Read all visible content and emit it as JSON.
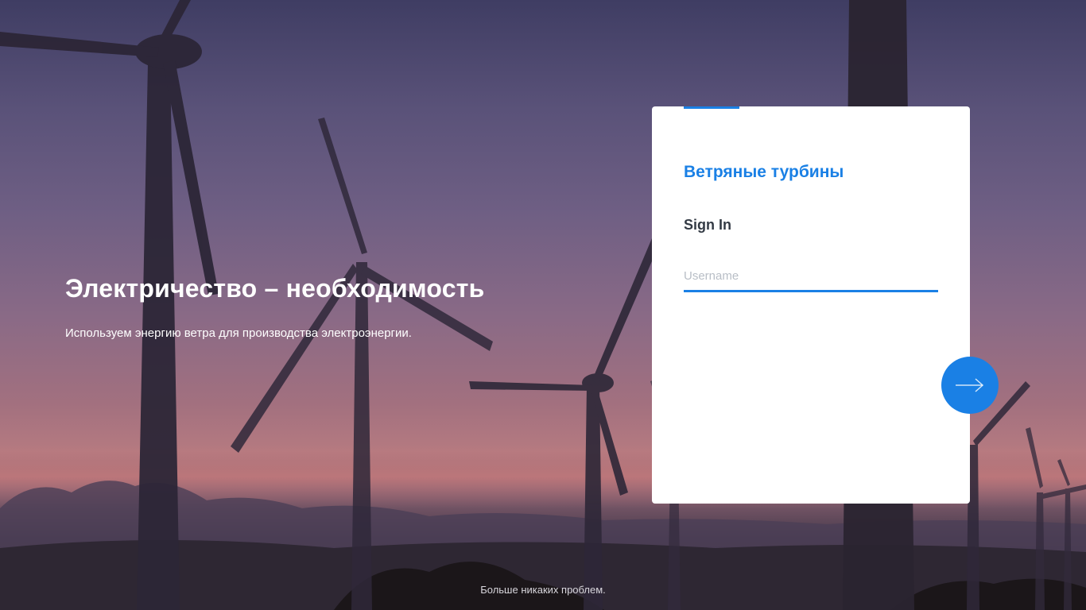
{
  "hero": {
    "title": "Электричество – необходимость",
    "subtitle": "Используем энергию ветра для производства электроэнергии."
  },
  "login": {
    "brand": "Ветряные турбины",
    "heading": "Sign In",
    "username_placeholder": "Username",
    "username_value": "",
    "next_icon": "arrow-right-icon"
  },
  "footer": {
    "text": "Больше никаких проблем."
  },
  "colors": {
    "accent": "#1a80e5",
    "heading_text": "#333a44"
  }
}
